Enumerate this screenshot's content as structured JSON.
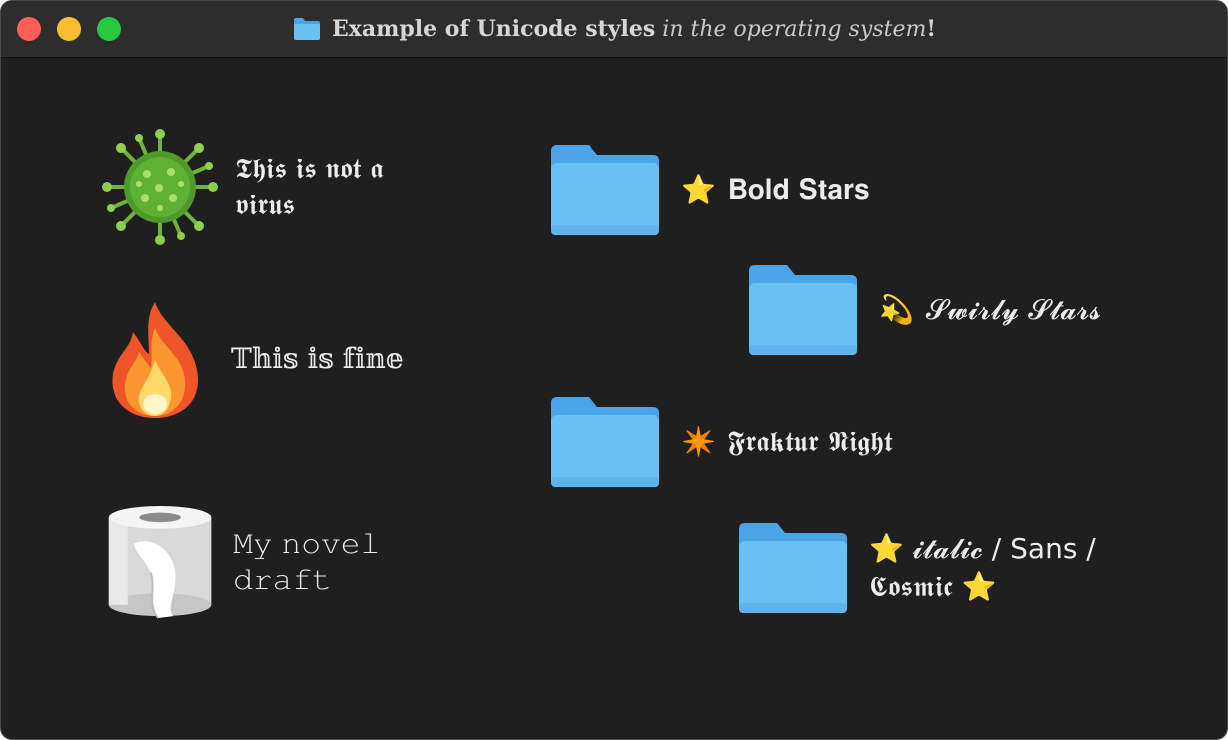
{
  "window": {
    "title_bold": "Example of Unicode styles",
    "title_italic": "in the operating system",
    "title_bang": "!"
  },
  "icons": {
    "title_icon": "folder-icon",
    "virus": "virus-icon",
    "fire": "fire-icon",
    "toilet_paper": "toilet-paper-icon",
    "folder": "folder-icon",
    "star": "star-icon",
    "dizzy": "dizzy-icon",
    "sparkle": "eight-pointed-star-icon"
  },
  "desktop": {
    "left_items": [
      {
        "label": "𝕿𝖍𝖎𝖘 𝖎𝖘 𝖓𝖔𝖙 𝖆 𝖛𝖎𝖗𝖚𝖘"
      },
      {
        "label": "𝕋𝕙𝕚𝕤 𝕚𝕤 𝕗𝕚𝕟𝕖"
      },
      {
        "label": "𝙼𝚢 𝚗𝚘𝚟𝚎𝚕 𝚍𝚛𝚊𝚏𝚝"
      }
    ],
    "folders": [
      {
        "emoji": "⭐",
        "label": "𝐁𝐨𝐥𝐝 𝐒𝐭𝐚𝐫𝐬"
      },
      {
        "emoji": "💫",
        "label": "𝓢𝔀𝓲𝓻𝓵𝔂 𝓢𝓽𝓪𝓻𝓼"
      },
      {
        "emoji": "✴️",
        "label": "𝕱𝖗𝖆𝖐𝖙𝖚𝖗 𝕹𝖎𝖌𝖍𝖙"
      },
      {
        "emoji_start": "⭐",
        "italic": "𝓲𝓽𝓪𝓵𝓲𝓬",
        "middle": " / Sans /",
        "cosmic": "𝕮𝖔𝖘𝖒𝖎𝖈",
        "emoji_end": "⭐"
      }
    ]
  },
  "colors": {
    "window_bg": "#1f1f1f",
    "titlebar_bg": "#2d2d2d",
    "folder_body": "#6ac0f4",
    "folder_tab": "#4aa5e8"
  }
}
